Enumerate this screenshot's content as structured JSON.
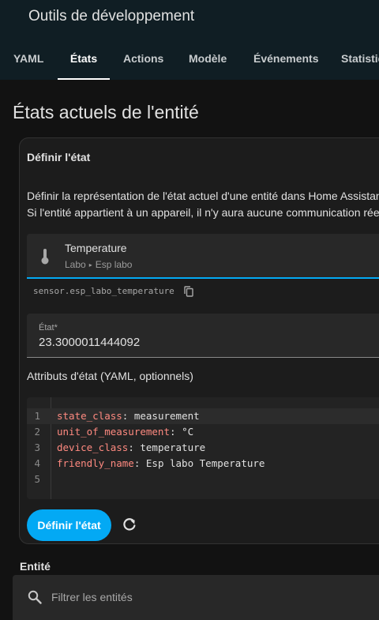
{
  "app": {
    "title": "Outils de développement"
  },
  "tabs": [
    {
      "label": "YAML"
    },
    {
      "label": "États"
    },
    {
      "label": "Actions"
    },
    {
      "label": "Modèle"
    },
    {
      "label": "Événements"
    },
    {
      "label": "Statistiques"
    }
  ],
  "active_tab": "États",
  "page": {
    "title": "États actuels de l'entité"
  },
  "card": {
    "header": "Définir l'état",
    "description_lines": [
      "Définir la représentation de l'état actuel d'une entité dans Home Assistant.",
      "Si l'entité appartient à un appareil, il n'y aura aucune communication réelle avec cet appareil."
    ],
    "entity": {
      "name": "Temperature",
      "area": "Labo",
      "device": "Esp labo",
      "icon": "thermometer-icon"
    },
    "entity_id": "sensor.esp_labo_temperature",
    "state_field": {
      "label": "État*",
      "value": "23.3000011444092"
    },
    "attributes_label": "Attributs d'état (YAML, optionnels)",
    "editor": {
      "lines": [
        {
          "number": "1",
          "key": "state_class",
          "sep": ": ",
          "value": "measurement"
        },
        {
          "number": "2",
          "key": "unit_of_measurement",
          "sep": ": ",
          "value": "°C"
        },
        {
          "number": "3",
          "key": "device_class",
          "sep": ": ",
          "value": "temperature"
        },
        {
          "number": "4",
          "key": "friendly_name",
          "sep": ": ",
          "value": "Esp labo Temperature"
        },
        {
          "number": "5",
          "key": "",
          "sep": "",
          "value": ""
        }
      ]
    },
    "set_button_label": "Définir l'état"
  },
  "entities_section": {
    "label": "Entité",
    "filter_placeholder": "Filtrer les entités"
  },
  "colors": {
    "accent": "#03a9f4",
    "yaml_key": "#ff8a80",
    "header_bg": "#101e24"
  }
}
